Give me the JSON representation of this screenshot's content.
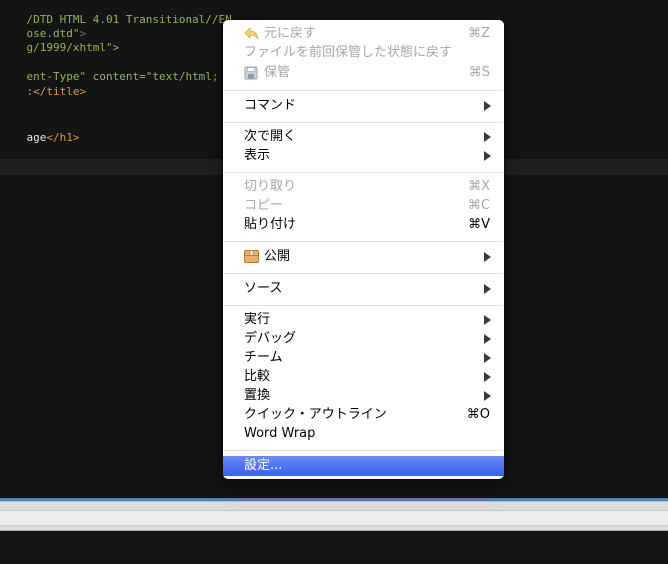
{
  "editor": {
    "lines": [
      {
        "t": "/DTD HTML 4.01 Transitional//EN",
        "c": "tok-green"
      },
      {
        "t": "ose.dtd\"",
        "c": "tok-green",
        "tail": ">"
      },
      {
        "t": "g/1999/xhtml\"",
        "c": "tok-green",
        "tail": ">"
      },
      {
        "t": "ent-Type\" content=\"text/html; ch",
        "c": "tok-green"
      },
      {
        "t": ":</title>",
        "c": "tok-orange"
      },
      {
        "t": "age",
        "c": "tok-white",
        "tail2": "</h1>"
      }
    ]
  },
  "menu": {
    "undo": {
      "label": "元に戻す",
      "shortcut": "⌘Z"
    },
    "revert": {
      "label": "ファイルを前回保管した状態に戻す"
    },
    "save": {
      "label": "保管",
      "shortcut": "⌘S"
    },
    "command": {
      "label": "コマンド"
    },
    "open_next": {
      "label": "次で開く"
    },
    "show": {
      "label": "表示"
    },
    "cut": {
      "label": "切り取り",
      "shortcut": "⌘X"
    },
    "copy": {
      "label": "コピー",
      "shortcut": "⌘C"
    },
    "paste": {
      "label": "貼り付け",
      "shortcut": "⌘V"
    },
    "publish": {
      "label": "公開"
    },
    "source": {
      "label": "ソース"
    },
    "run": {
      "label": "実行"
    },
    "debug": {
      "label": "デバッグ"
    },
    "team": {
      "label": "チーム"
    },
    "compare": {
      "label": "比較"
    },
    "replace": {
      "label": "置換"
    },
    "quick_outline": {
      "label": "クイック・アウトライン",
      "shortcut": "⌘O"
    },
    "word_wrap": {
      "label": "Word Wrap"
    },
    "settings": {
      "label": "設定..."
    }
  },
  "colors": {
    "selection": "#3b5ff0",
    "editor_bg": "#141414"
  },
  "icons": {
    "undo": "undo-arrow-icon",
    "save": "floppy-disk-icon",
    "publish": "package-box-icon"
  }
}
